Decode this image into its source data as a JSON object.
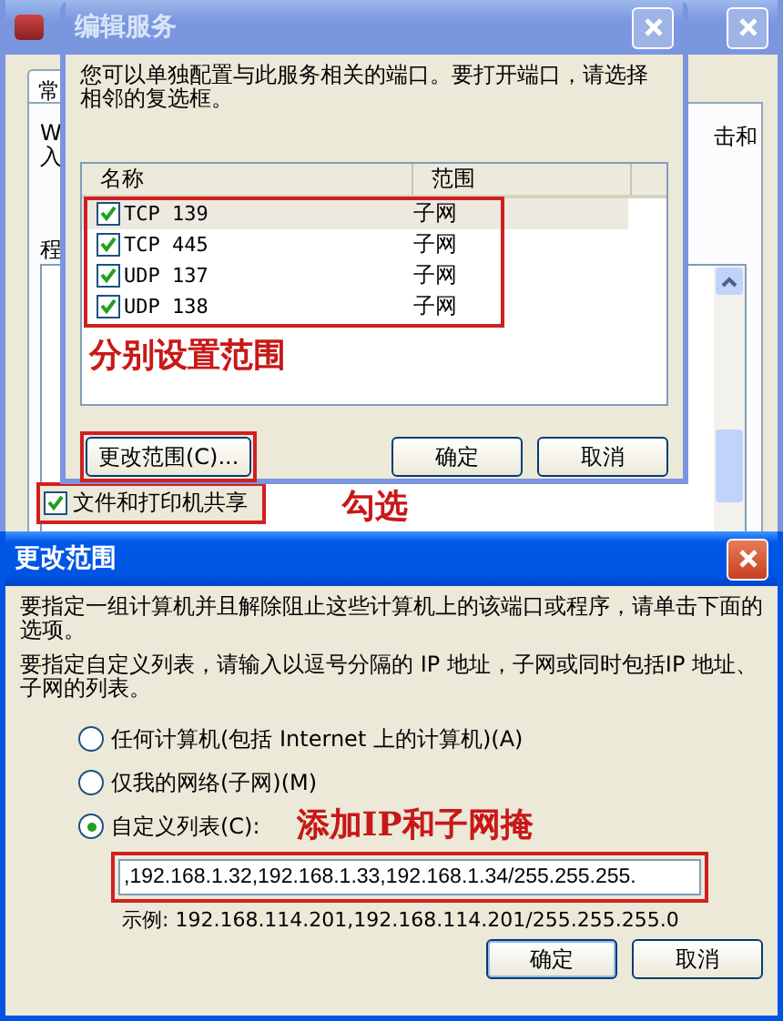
{
  "background_window": {
    "tab": "常",
    "text_left": "W",
    "text_left_2": "入",
    "text_right": "击和",
    "label": "程",
    "items": [
      {
        "label": "文件和打印机共享",
        "checked": true
      }
    ]
  },
  "edit_service_dialog": {
    "title": "编辑服务",
    "description": "您可以单独配置与此服务相关的端口。要打开端口，请选择相邻的复选框。",
    "columns": [
      "名称",
      "范围"
    ],
    "ports": [
      {
        "name": "TCP 139",
        "scope": "子网",
        "checked": true,
        "selected": true
      },
      {
        "name": "TCP 445",
        "scope": "子网",
        "checked": true,
        "selected": false
      },
      {
        "name": "UDP 137",
        "scope": "子网",
        "checked": true,
        "selected": false
      },
      {
        "name": "UDP 138",
        "scope": "子网",
        "checked": true,
        "selected": false
      }
    ],
    "buttons": [
      {
        "label": "更改范围(C)...",
        "kind": "action"
      },
      {
        "label": "确定",
        "kind": "ok"
      },
      {
        "label": "取消",
        "kind": "cancel"
      }
    ]
  },
  "change_scope_dialog": {
    "title": "更改范围",
    "description": "要指定一组计算机并且解除阻止这些计算机上的该端口或程序，请单击下面的选项。",
    "description_2": "要指定自定义列表，请输入以逗号分隔的 IP 地址，子网或同时包括IP 地址、子网的列表。",
    "options": [
      {
        "label": "任何计算机(包括 Internet 上的计算机)(A)",
        "selected": false
      },
      {
        "label": "仅我的网络(子网)(M)",
        "selected": false
      },
      {
        "label": "自定义列表(C):",
        "selected": true
      }
    ],
    "custom_list": {
      "value": ",192.168.1.32,192.168.1.33,192.168.1.34/255.255.255."
    },
    "example": "示例: 192.168.114.201,192.168.114.201/255.255.255.0",
    "buttons": [
      {
        "label": "确定",
        "kind": "ok"
      },
      {
        "label": "取消",
        "kind": "cancel"
      }
    ]
  },
  "annotations": {
    "ports": "分别设置范围",
    "checkbox": "勾选",
    "custom_list": "添加IP和子网掩"
  }
}
